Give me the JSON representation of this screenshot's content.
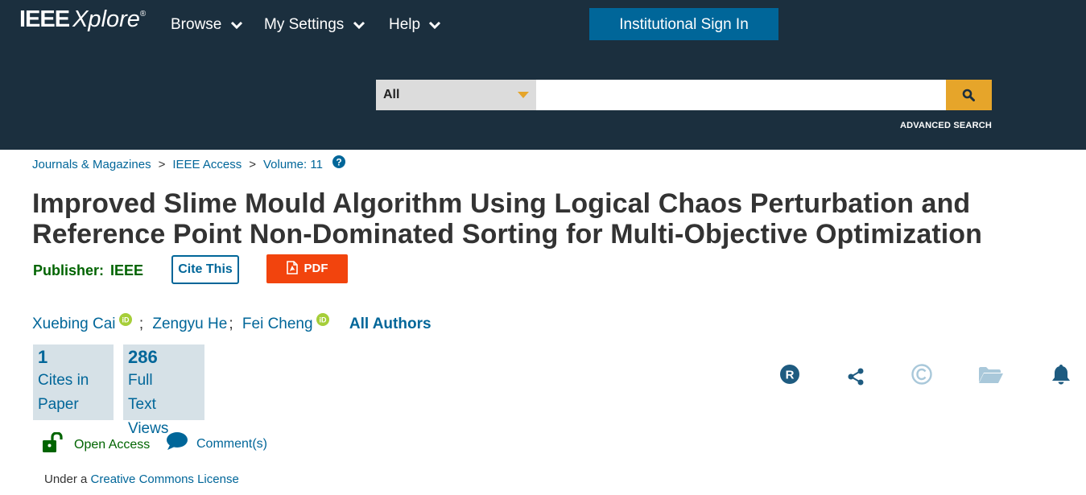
{
  "header": {
    "logo_main": "IEEE",
    "logo_sub": "Xplore",
    "logo_mark": "®",
    "nav": [
      {
        "label": "Browse",
        "icon": "chevron-down-icon"
      },
      {
        "label": "My Settings",
        "icon": "chevron-down-icon"
      },
      {
        "label": "Help",
        "icon": "chevron-down-icon"
      }
    ],
    "signin_label": "Institutional Sign In",
    "search": {
      "scope": "All",
      "value": "",
      "placeholder": "",
      "button_icon": "search-icon"
    },
    "advanced_search": "ADVANCED SEARCH"
  },
  "breadcrumb": {
    "items": [
      "Journals & Magazines",
      "IEEE Access",
      "Volume: 11"
    ],
    "separator": ">",
    "help_icon": "question-circle-icon"
  },
  "article": {
    "title_line1": "Improved Slime Mould Algorithm Using Logical Chaos Perturbation and",
    "title_line2": "Reference Point Non-Dominated Sorting for Multi-Objective Optimization",
    "publisher_label": "Publisher:",
    "publisher_value": "IEEE",
    "cite_label": "Cite This",
    "pdf_label": "PDF",
    "authors": [
      {
        "name": "Xuebing Cai",
        "orcid": true
      },
      {
        "name": "Zengyu He",
        "orcid": false
      },
      {
        "name": "Fei Cheng",
        "orcid": true
      }
    ],
    "author_sep": ";",
    "all_authors": "All Authors",
    "metrics": [
      {
        "number": "1",
        "lines": [
          "Cites in",
          "Paper"
        ]
      },
      {
        "number": "286",
        "lines": [
          "Full",
          "Text",
          "Views"
        ]
      }
    ],
    "tools": [
      "rights-r-icon",
      "share-icon",
      "copyright-icon",
      "folder-icon",
      "bell-icon"
    ],
    "access_label": "Open Access",
    "comment_label": "Comment(s)",
    "license_prefix": "Under a",
    "license_link": "Creative Commons License"
  },
  "colors": {
    "header_bg": "#1b2f3e",
    "link": "#006699",
    "accent_orange": "#e6a52a",
    "pdf_red": "#f2440d",
    "publisher_green": "#006400",
    "metric_bg": "#d6e1e7",
    "orcid_green": "#a6ce39"
  }
}
